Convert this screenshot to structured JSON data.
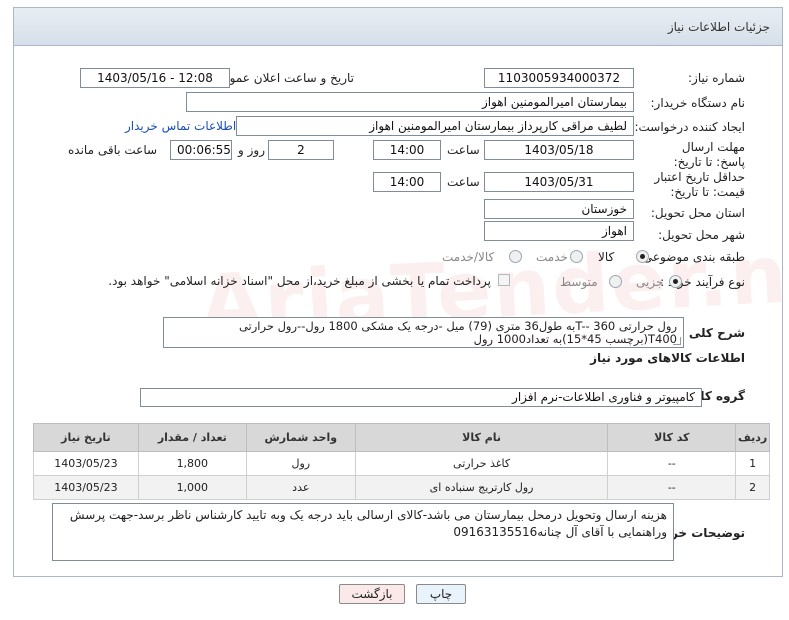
{
  "header": {
    "title": "جزئیات اطلاعات نیاز"
  },
  "form": {
    "need_number_label": "شماره نیاز:",
    "need_number": "1103005934000372",
    "announce_label": "تاریخ و ساعت اعلان عمومی:",
    "announce_value": "1403/05/16 - 12:08",
    "buyer_org_label": "نام دستگاه خریدار:",
    "buyer_org": "بیمارستان امیرالمومنین اهواز",
    "creator_label": "ایجاد کننده درخواست:",
    "creator": "لطیف مراقی کارپرداز بیمارستان امیرالمومنین اهواز",
    "contact_link": "اطلاعات تماس خریدار",
    "reply_deadline_label": "مهلت ارسال پاسخ: تا تاریخ:",
    "reply_date": "1403/05/18",
    "time_label": "ساعت",
    "reply_time": "14:00",
    "days": "2",
    "days_label": "روز و",
    "remaining": "00:06:55",
    "remaining_label": "ساعت باقی مانده",
    "price_valid_label": "حداقل تاریخ اعتبار قیمت: تا تاریخ:",
    "price_date": "1403/05/31",
    "price_time": "14:00",
    "province_label": "استان محل تحویل:",
    "province": "خوزستان",
    "city_label": "شهر محل تحویل:",
    "city": "اهواز",
    "category_label": "طبقه بندی موضوعی:",
    "category_options": [
      "کالا",
      "خدمت",
      "کالا/خدمت"
    ],
    "process_label": "نوع فرآیند خرید :",
    "process_options": [
      "جزیی",
      "متوسط"
    ],
    "payment_note": "پرداخت تمام یا بخشی از مبلغ خرید،از محل \"اسناد خزانه اسلامی\" خواهد بود.",
    "desc_label": "شرح کلی نیاز:",
    "description": "رول حرارتی  T-- 360به طول36 متری (79) میل -درجه یک مشکی 1800 رول--رول حرارتی T400(برچسب 45*15)به تعداد1000 رول",
    "goods_info_title": "اطلاعات کالاهای مورد نیاز",
    "goods_group_label": "گروه کالا:",
    "goods_group": "کامپیوتر و فناوری اطلاعات-نرم افزار",
    "buyer_notes_label": "توضیحات خریدار:",
    "buyer_notes": "هزینه ارسال وتحویل درمحل بیمارستان می باشد-کالای ارسالی باید درجه یک وبه تایید کارشناس ناظر برسد-جهت پرسش وراهنمایی با آقای آل چنانه09163135516"
  },
  "table": {
    "headers": [
      "ردیف",
      "کد کالا",
      "نام کالا",
      "واحد شمارش",
      "تعداد / مقدار",
      "تاریخ نیاز"
    ],
    "rows": [
      [
        "1",
        "--",
        "کاغذ حرارتی",
        "رول",
        "1,800",
        "1403/05/23"
      ],
      [
        "2",
        "--",
        "رول کارتریج سنباده ای",
        "عدد",
        "1,000",
        "1403/05/23"
      ]
    ]
  },
  "buttons": {
    "print": "چاپ",
    "back": "بازگشت"
  },
  "watermark": "AriaTender.neT"
}
